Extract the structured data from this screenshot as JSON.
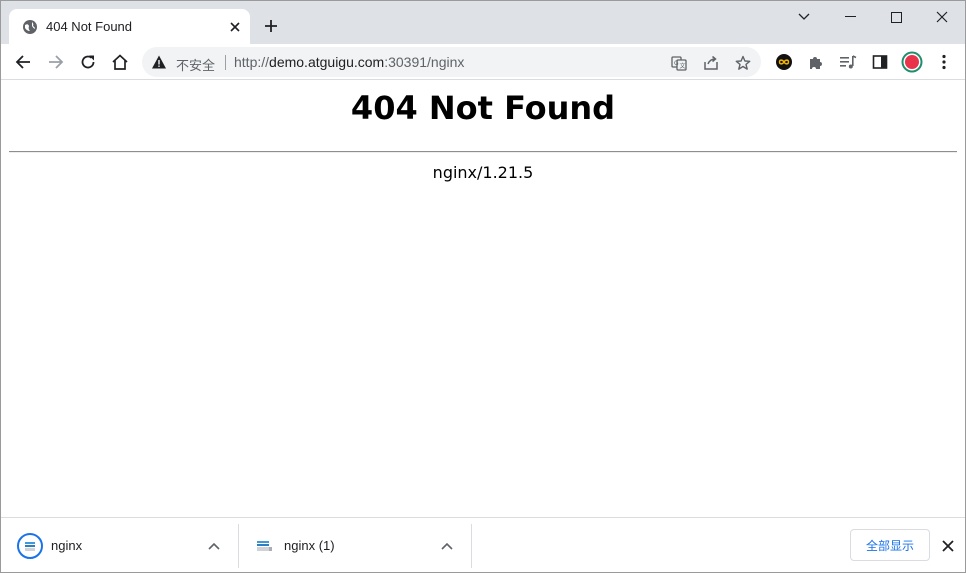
{
  "tab": {
    "title": "404 Not Found",
    "favicon_icon": "globe-icon",
    "close_icon": "close-icon"
  },
  "new_tab_icon": "plus-icon",
  "window_controls": {
    "minimize_icon": "minimize-icon",
    "maximize_icon": "maximize-icon",
    "close_icon": "close-icon",
    "tab_search_icon": "chevron-down-icon"
  },
  "toolbar": {
    "back_icon": "back-arrow-icon",
    "forward_icon": "forward-arrow-icon",
    "reload_icon": "reload-icon",
    "home_icon": "home-icon"
  },
  "omnibox": {
    "security_label": "不安全",
    "url_scheme": "http://",
    "url_host": "demo.atguigu.com",
    "url_rest": ":30391/nginx",
    "warning_icon": "warning-icon",
    "translate_icon": "translate-icon",
    "share_icon": "share-icon",
    "bookmark_icon": "star-icon"
  },
  "extensions": {
    "extension_icon": "infinity-extension-icon",
    "puzzle_icon": "puzzle-icon",
    "media_icon": "media-queue-icon",
    "side_panel_icon": "side-panel-icon",
    "profile_icon": "avatar",
    "menu_icon": "kebab-menu-icon"
  },
  "page": {
    "heading": "404 Not Found",
    "server": "nginx/1.21.5"
  },
  "downloads": {
    "items": [
      {
        "name": "nginx",
        "icon": "download-progress-icon"
      },
      {
        "name": "nginx (1)",
        "icon": "file-icon"
      }
    ],
    "show_all_label": "全部显示",
    "close_icon": "close-icon"
  },
  "colors": {
    "tabstrip_bg": "#dee1e6",
    "omnibox_bg": "#f1f3f4",
    "accent_blue": "#1a73e8",
    "profile_ring": "#1e8e6e",
    "profile_fill": "#e8334a"
  }
}
